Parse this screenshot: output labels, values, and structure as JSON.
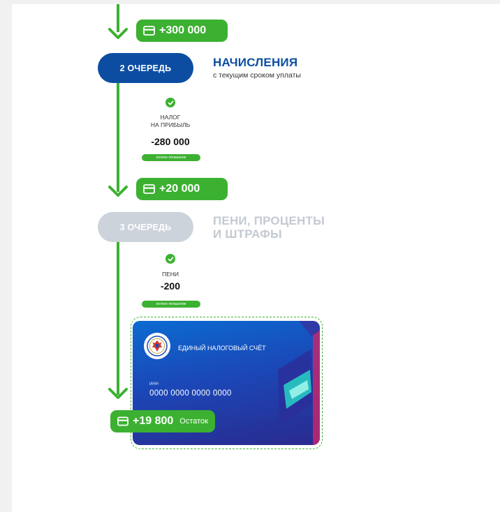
{
  "flow": {
    "top_badge": {
      "amount": "+300 000",
      "icon": "card-icon"
    },
    "queue2": {
      "pill": "2 ОЧЕРЕДЬ",
      "title": "НАЧИСЛЕНИЯ",
      "subtitle": "с текущим сроком уплаты",
      "item": {
        "label_line1": "налог",
        "label_line2": "на прибыль",
        "amount": "-280 000",
        "status": "полное погашение"
      }
    },
    "middle_badge": {
      "amount": "+20 000",
      "icon": "card-icon"
    },
    "queue3": {
      "pill": "3 ОЧЕРЕДЬ",
      "title_line1": "ПЕНИ, ПРОЦЕНТЫ",
      "title_line2": "И ШТРАФЫ",
      "item": {
        "label": "пени",
        "amount": "-200",
        "status": "полное погашение"
      }
    },
    "bottom_badge": {
      "amount": "+19 800",
      "note": "Остаток",
      "icon": "card-icon"
    }
  },
  "card": {
    "title": "ЕДИНЫЙ НАЛОГОВЫЙ СЧЁТ",
    "inn_label": "ИНН",
    "number": "0000 0000 0000 0000",
    "emblem": "fns-emblem-icon"
  },
  "colors": {
    "green": "#3cb131",
    "blue": "#0c4da2",
    "muted": "#cdd3da",
    "muted_text": "#c4cad2"
  }
}
